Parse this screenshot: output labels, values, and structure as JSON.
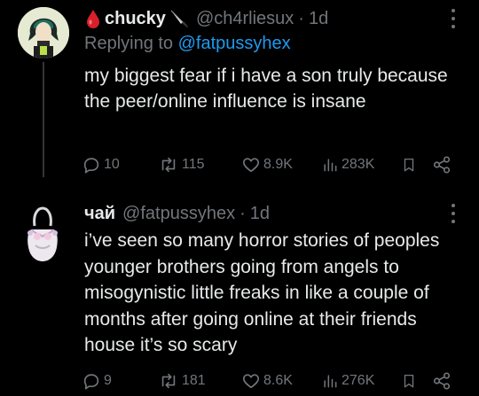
{
  "tweets": [
    {
      "display_name": "chucky",
      "handle": "@ch4rliesux",
      "separator": "·",
      "time": "1d",
      "replying_prefix": "Replying to ",
      "replying_to": "@fatpussyhex",
      "text": "my biggest fear if i have a son truly because the peer/online influence is insane",
      "replies": "10",
      "reposts": "115",
      "likes": "8.9K",
      "views": "283K"
    },
    {
      "display_name": "чай",
      "handle": "@fatpussyhex",
      "separator": "·",
      "time": "1d",
      "text": "i’ve seen so many horror stories of peoples younger brothers going from angels to misogynistic little freaks in like a couple of months after going online at their friends house it’s so scary",
      "replies": "9",
      "reposts": "181",
      "likes": "8.6K",
      "views": "276K"
    }
  ],
  "colors": {
    "background": "#000000",
    "text": "#e7e9ea",
    "muted": "#71767b",
    "link": "#1d9bf0"
  },
  "icons": [
    "drop-of-blood-icon",
    "knife-icon",
    "more-icon",
    "reply-icon",
    "repost-icon",
    "like-icon",
    "views-icon",
    "bookmark-icon",
    "share-icon"
  ]
}
